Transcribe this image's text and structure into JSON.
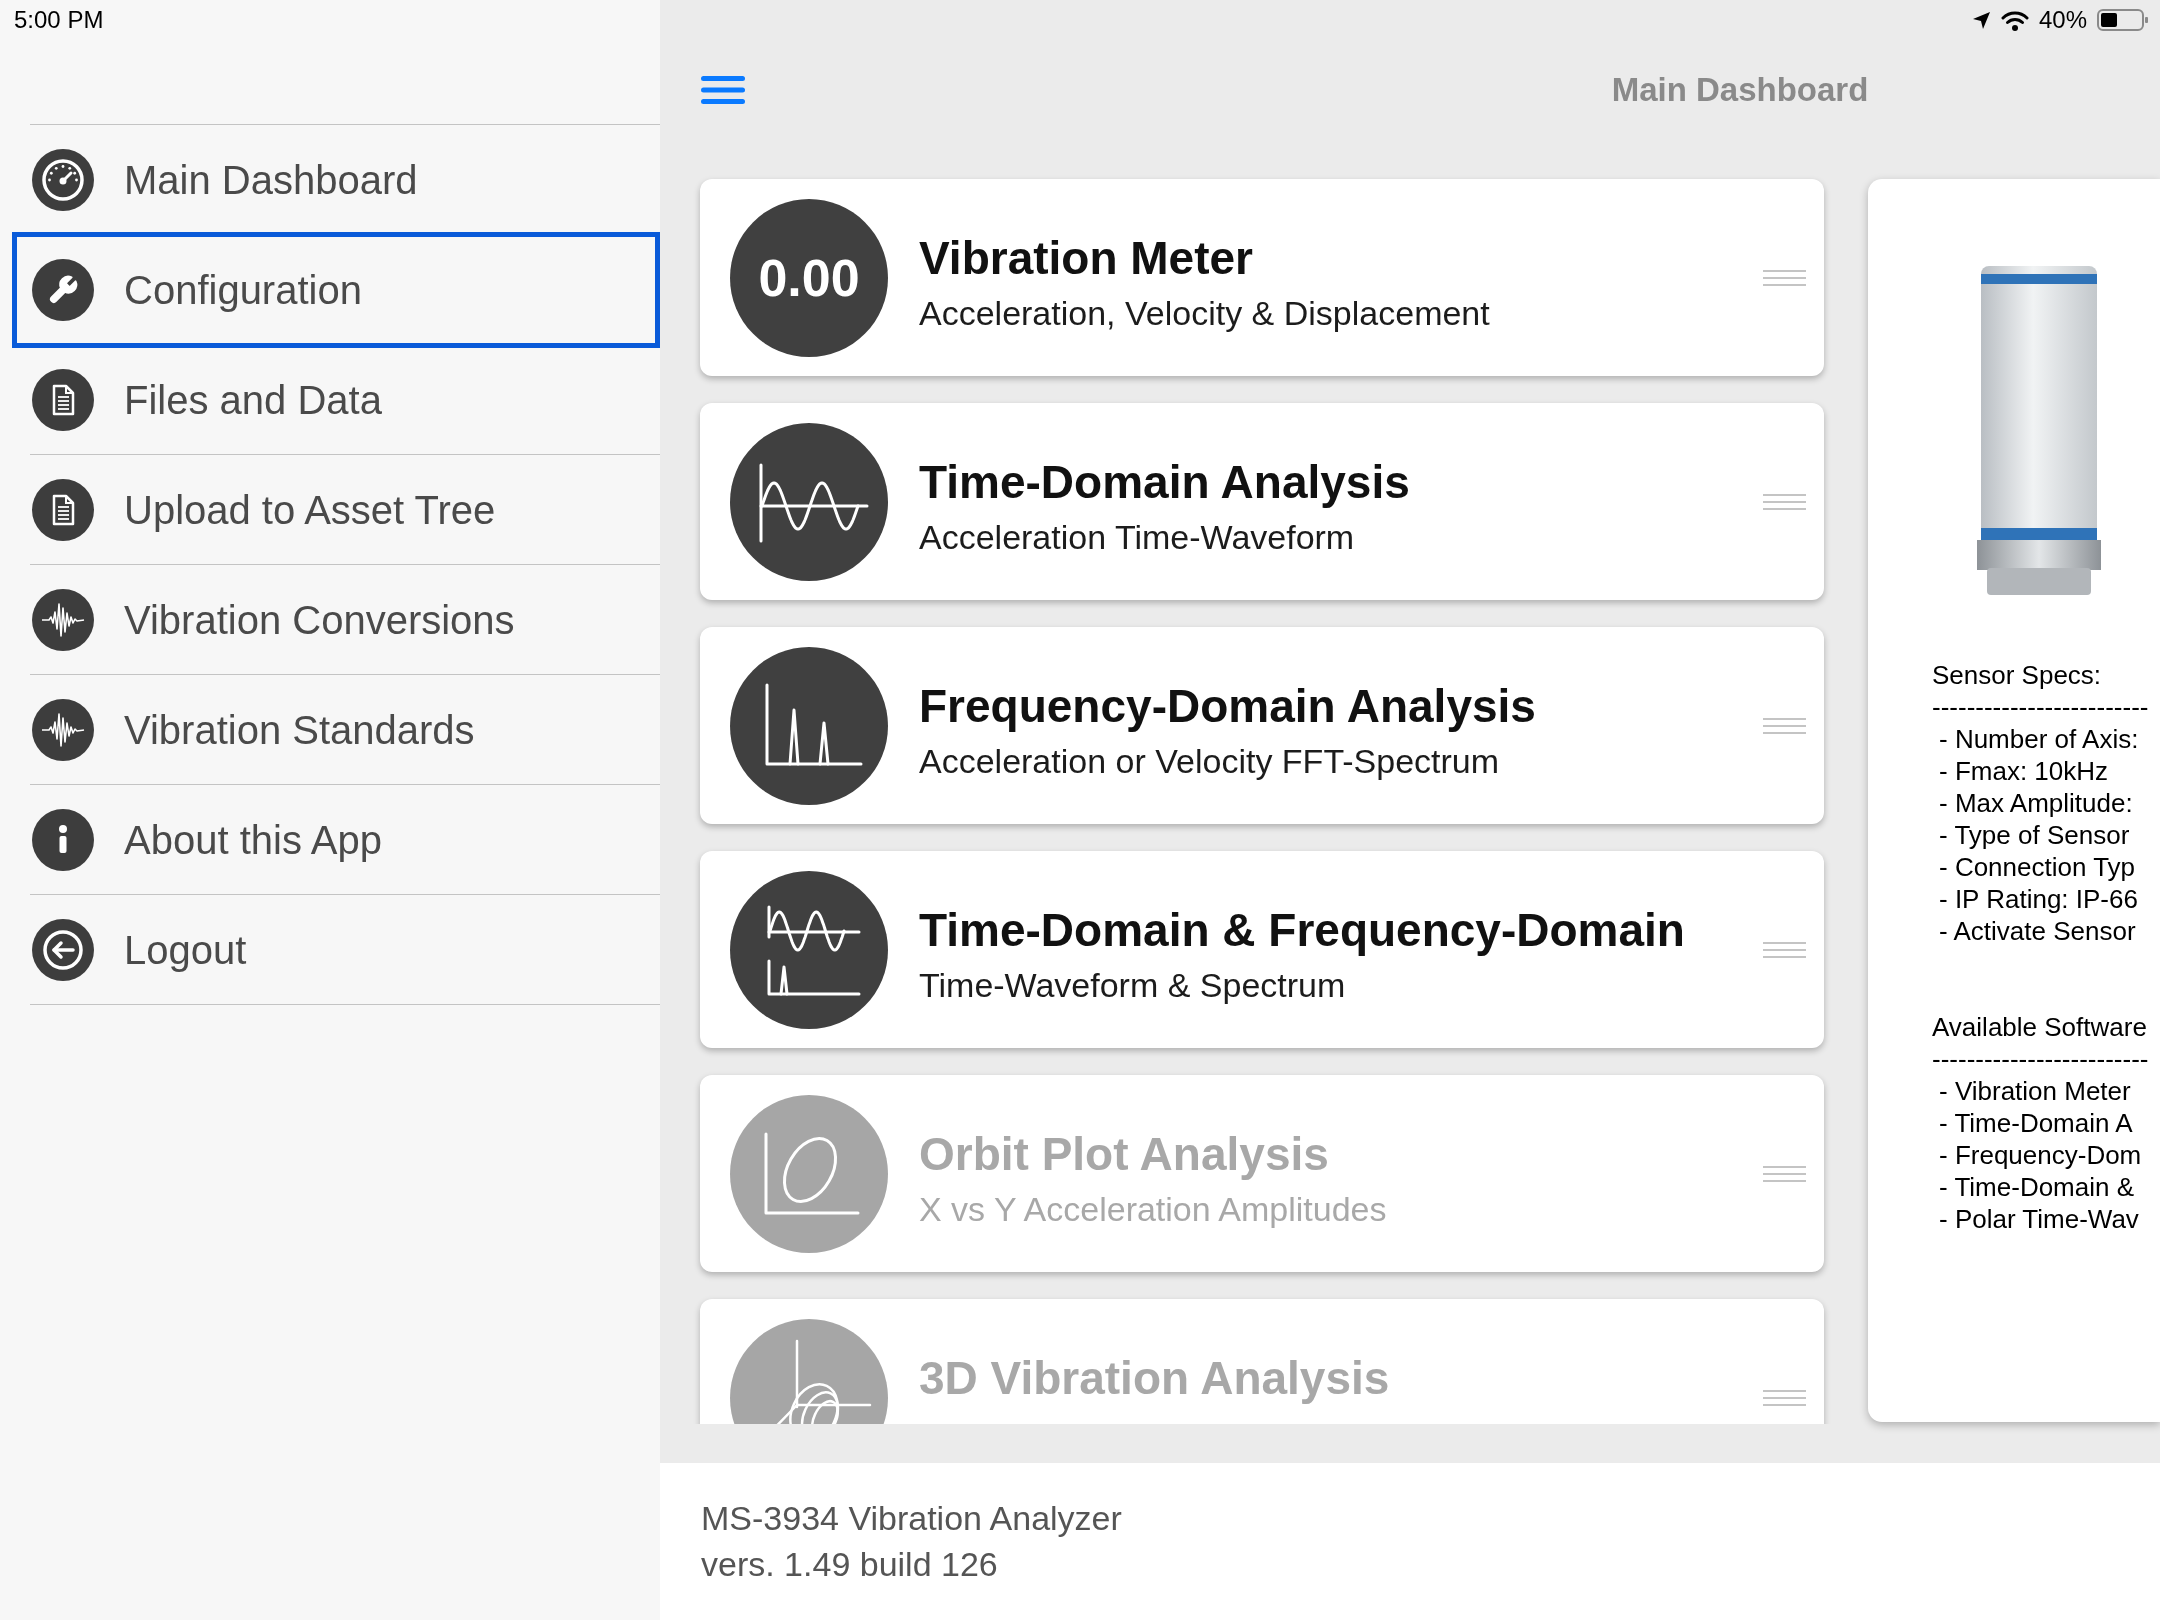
{
  "status_bar": {
    "time": "5:00 PM",
    "battery": "40%"
  },
  "sidebar": {
    "items": [
      {
        "label": "Main Dashboard",
        "selected": false
      },
      {
        "label": "Configuration",
        "selected": true
      },
      {
        "label": "Files and Data",
        "selected": false
      },
      {
        "label": "Upload to Asset Tree",
        "selected": false
      },
      {
        "label": "Vibration Conversions",
        "selected": false
      },
      {
        "label": "Vibration Standards",
        "selected": false
      },
      {
        "label": "About this App",
        "selected": false
      },
      {
        "label": "Logout",
        "selected": false
      }
    ]
  },
  "header": {
    "title": "Main Dashboard"
  },
  "cards": [
    {
      "kind": "meter",
      "reading": "0.00",
      "title": "Vibration Meter",
      "subtitle": "Acceleration, Velocity & Displacement",
      "disabled": false
    },
    {
      "kind": "time",
      "title": "Time-Domain Analysis",
      "subtitle": "Acceleration Time-Waveform",
      "disabled": false
    },
    {
      "kind": "frequency",
      "title": "Frequency-Domain Analysis",
      "subtitle": "Acceleration or Velocity FFT-Spectrum",
      "disabled": false
    },
    {
      "kind": "combined",
      "title": "Time-Domain & Frequency-Domain",
      "subtitle": "Time-Waveform & Spectrum",
      "disabled": false
    },
    {
      "kind": "orbit",
      "title": "Orbit Plot Analysis",
      "subtitle": "X vs Y Acceleration Amplitudes",
      "disabled": true
    },
    {
      "kind": "spiral",
      "title": "3D Vibration Analysis",
      "disabled": true
    }
  ],
  "sensor_panel": {
    "sections": [
      {
        "heading": "Sensor Specs:",
        "rule": "-------------------------",
        "items": [
          "- Number of Axis:",
          "- Fmax: 10kHz",
          "- Max Amplitude:",
          "- Type of Sensor",
          "- Connection Typ",
          "- IP Rating: IP-66",
          "- Activate Sensor"
        ]
      },
      {
        "heading": "Available Software",
        "rule": "-------------------------",
        "items": [
          "- Vibration Meter",
          "- Time-Domain A",
          "- Frequency-Dom",
          "- Time-Domain &",
          "- Polar Time-Wav"
        ]
      }
    ]
  },
  "footer": {
    "lines": [
      "MS-3934 Vibration Analyzer",
      "vers. 1.49 build 126"
    ]
  }
}
